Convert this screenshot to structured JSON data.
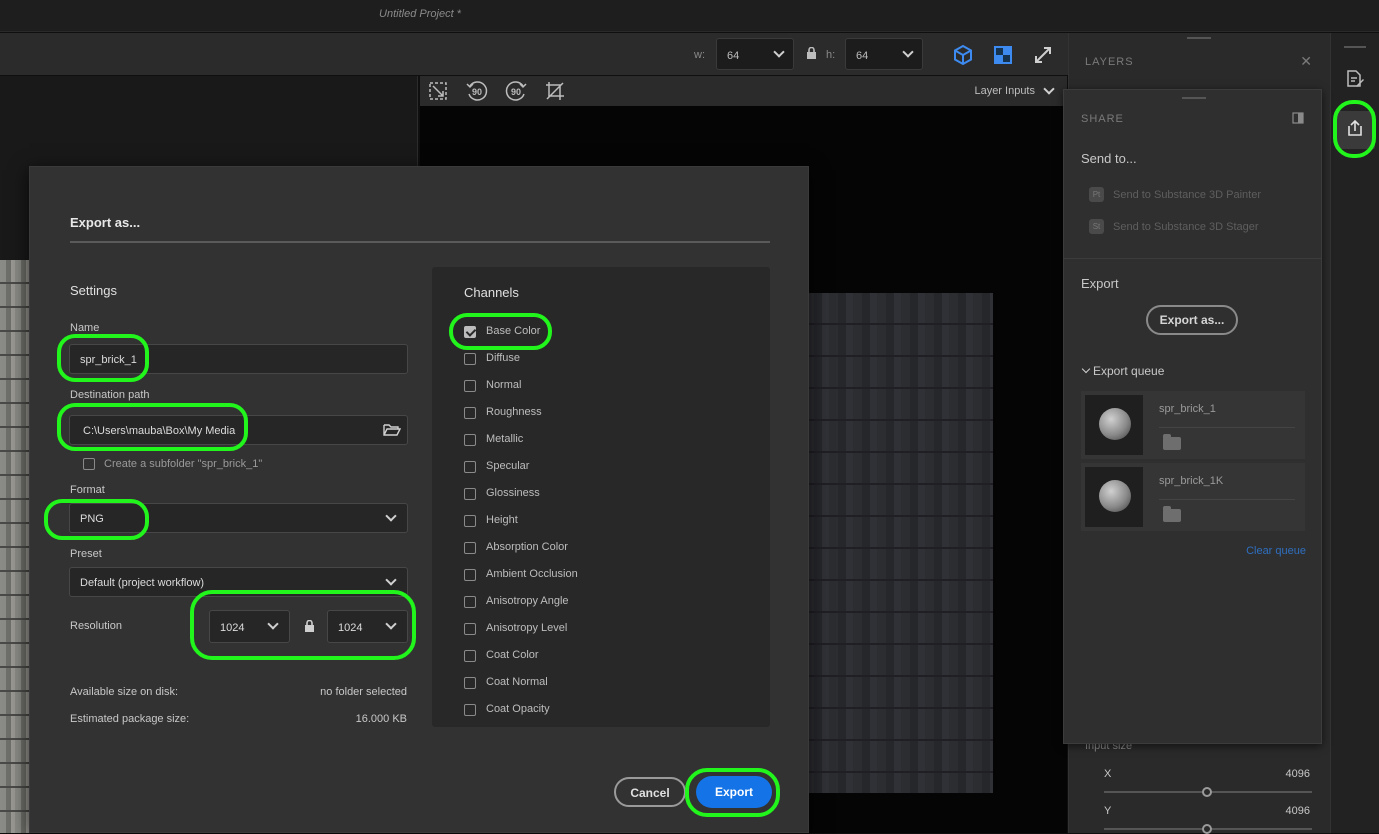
{
  "app": {
    "project_title": "Untitled Project *"
  },
  "toolbar": {
    "w_label": "w:",
    "w_value": "64",
    "h_label": "h:",
    "h_value": "64"
  },
  "viewport": {
    "layer_inputs": "Layer Inputs"
  },
  "layers_panel": {
    "title": "LAYERS"
  },
  "share_panel": {
    "title": "SHARE",
    "send_to": "Send to...",
    "send_items": [
      {
        "badge": "Pt",
        "label": "Send to Substance 3D Painter"
      },
      {
        "badge": "St",
        "label": "Send to Substance 3D Stager"
      }
    ],
    "export_heading": "Export",
    "export_as_button": "Export as...",
    "export_queue": "Export queue",
    "queue": [
      {
        "name": "spr_brick_1"
      },
      {
        "name": "spr_brick_1K"
      }
    ],
    "clear_queue": "Clear queue"
  },
  "input_size": {
    "label": "Input size",
    "x_label": "X",
    "x_value": "4096",
    "y_label": "Y",
    "y_value": "4096"
  },
  "dialog": {
    "title": "Export as...",
    "settings_heading": "Settings",
    "name_label": "Name",
    "name_value": "spr_brick_1",
    "dest_label": "Destination path",
    "dest_value": "C:\\Users\\mauba\\Box\\My Media",
    "subfolder_label": "Create a subfolder \"spr_brick_1\"",
    "format_label": "Format",
    "format_value": "PNG",
    "preset_label": "Preset",
    "preset_value": "Default (project workflow)",
    "resolution_label": "Resolution",
    "res_w": "1024",
    "res_h": "1024",
    "disk_label": "Available size on disk:",
    "disk_value": "no folder selected",
    "pkg_label": "Estimated package size:",
    "pkg_value": "16.000 KB",
    "channels_heading": "Channels",
    "channels": [
      {
        "label": "Base Color",
        "checked": true
      },
      {
        "label": "Diffuse",
        "checked": false
      },
      {
        "label": "Normal",
        "checked": false
      },
      {
        "label": "Roughness",
        "checked": false
      },
      {
        "label": "Metallic",
        "checked": false
      },
      {
        "label": "Specular",
        "checked": false
      },
      {
        "label": "Glossiness",
        "checked": false
      },
      {
        "label": "Height",
        "checked": false
      },
      {
        "label": "Absorption Color",
        "checked": false
      },
      {
        "label": "Ambient Occlusion",
        "checked": false
      },
      {
        "label": "Anisotropy Angle",
        "checked": false
      },
      {
        "label": "Anisotropy Level",
        "checked": false
      },
      {
        "label": "Coat Color",
        "checked": false
      },
      {
        "label": "Coat Normal",
        "checked": false
      },
      {
        "label": "Coat Opacity",
        "checked": false
      }
    ],
    "cancel": "Cancel",
    "export": "Export"
  },
  "colors": {
    "accent": "#1473e6",
    "highlight": "#22f51c"
  }
}
